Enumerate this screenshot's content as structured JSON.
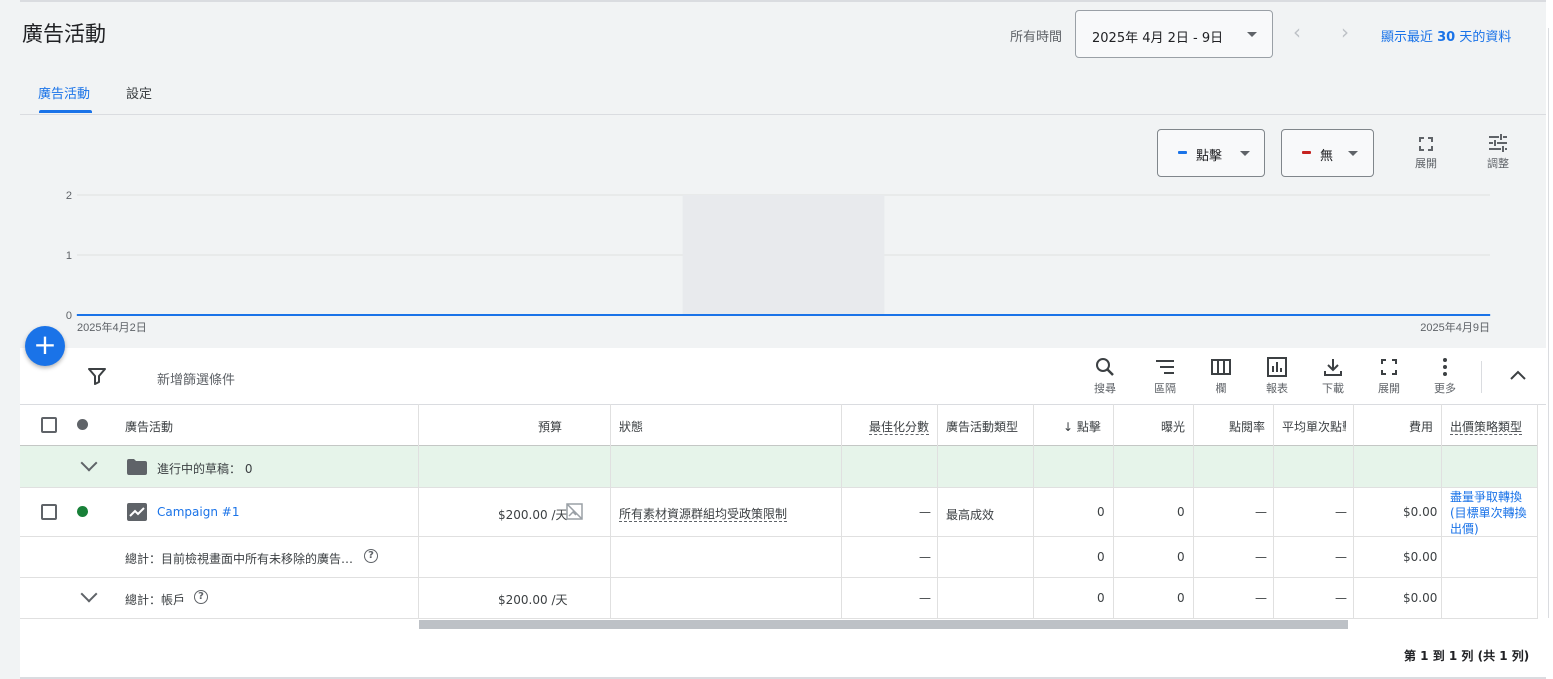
{
  "page": {
    "title": "廣告活動",
    "time_label": "所有時間",
    "date_range": "2025年 4月 2日 - 9日",
    "recent_prefix": "顯示最近 ",
    "recent_num": "30",
    "recent_suffix": " 天的資料"
  },
  "tabs": [
    {
      "label": "廣告活動",
      "active": true
    },
    {
      "label": "設定",
      "active": false
    }
  ],
  "chart_controls": {
    "metric1": {
      "label": "點擊",
      "color": "#1a73e8"
    },
    "metric2": {
      "label": "無",
      "color": "#c5221f"
    },
    "expand_label": "展開",
    "adjust_label": "調整"
  },
  "chart_data": {
    "type": "line",
    "x": [
      "2025年4月2日",
      "2025年4月3日",
      "2025年4月4日",
      "2025年4月5日",
      "2025年4月6日",
      "2025年4月7日",
      "2025年4月8日",
      "2025年4月9日"
    ],
    "series": [
      {
        "name": "點擊",
        "values": [
          0,
          0,
          0,
          0,
          0,
          0,
          0,
          0
        ],
        "color": "#1a73e8"
      }
    ],
    "y_ticks": [
      "0",
      "1",
      "2"
    ],
    "ylim": [
      0,
      2
    ],
    "x_tick_labels": [
      "2025年4月2日",
      "2025年4月9日"
    ],
    "highlighted_x_range": [
      "2025年4月5日",
      "2025年4月6日"
    ],
    "grid": true
  },
  "toolbar": {
    "add_filter": "新增篩選條件",
    "search": "搜尋",
    "segment": "區隔",
    "columns": "欄",
    "reports": "報表",
    "download": "下載",
    "expand": "展開",
    "more": "更多"
  },
  "table": {
    "headers": {
      "campaign": "廣告活動",
      "budget": "預算",
      "status": "狀態",
      "opt_score": "最佳化分數",
      "campaign_type": "廣告活動類型",
      "clicks": "點擊",
      "impressions": "曝光",
      "ctr": "點閱率",
      "avg_cpc": "平均單次點擊",
      "cost": "費用",
      "bid_strategy": "出價策略類型"
    },
    "draft_row": {
      "label": "進行中的草稿：",
      "count": "0"
    },
    "campaign_row": {
      "name": "Campaign #1",
      "budget": "$200.00 /天",
      "status": "所有素材資源群組均受政策限制",
      "opt_score": "—",
      "campaign_type": "最高成效",
      "clicks": "0",
      "impressions": "0",
      "ctr": "—",
      "avg_cpc": "—",
      "cost": "$0.00",
      "bid_line1": "盡量爭取轉換",
      "bid_line2": "(目標單次轉換",
      "bid_line3": "出價)"
    },
    "total_filtered": {
      "label": "總計：目前檢視畫面中所有未移除的廣告…",
      "opt_score": "—",
      "clicks": "0",
      "impressions": "0",
      "ctr": "—",
      "avg_cpc": "—",
      "cost": "$0.00"
    },
    "total_account": {
      "label": "總計：帳戶",
      "budget": "$200.00 /天",
      "opt_score": "—",
      "clicks": "0",
      "impressions": "0",
      "ctr": "—",
      "avg_cpc": "—",
      "cost": "$0.00"
    }
  },
  "pagination": "第 1 到 1 列 (共 1 列)"
}
